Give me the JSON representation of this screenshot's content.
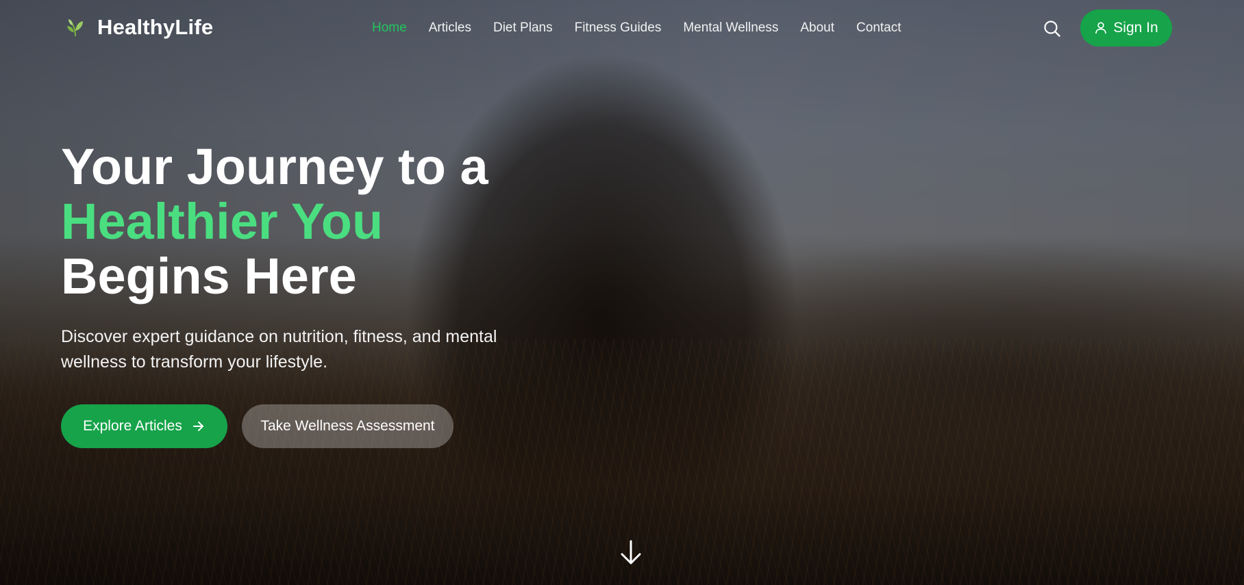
{
  "brand": {
    "name": "HealthyLife",
    "logo_icon": "leaf-sprout-icon",
    "accent_color": "#22c55e",
    "button_color": "#16a34a"
  },
  "nav": {
    "links": [
      {
        "label": "Home",
        "active": true
      },
      {
        "label": "Articles",
        "active": false
      },
      {
        "label": "Diet Plans",
        "active": false
      },
      {
        "label": "Fitness Guides",
        "active": false
      },
      {
        "label": "Mental Wellness",
        "active": false
      },
      {
        "label": "About",
        "active": false
      },
      {
        "label": "Contact",
        "active": false
      }
    ],
    "search_icon": "search-icon",
    "signin_label": "Sign In",
    "signin_icon": "user-icon"
  },
  "hero": {
    "title_line1": "Your Journey to a",
    "title_highlight": "Healthier You",
    "title_line3": "Begins Here",
    "subtitle": "Discover expert guidance on nutrition, fitness, and mental wellness to transform your lifestyle.",
    "primary_button": "Explore Articles",
    "primary_button_icon": "arrow-right-icon",
    "secondary_button": "Take Wellness Assessment",
    "scroll_icon": "arrow-down-icon"
  }
}
